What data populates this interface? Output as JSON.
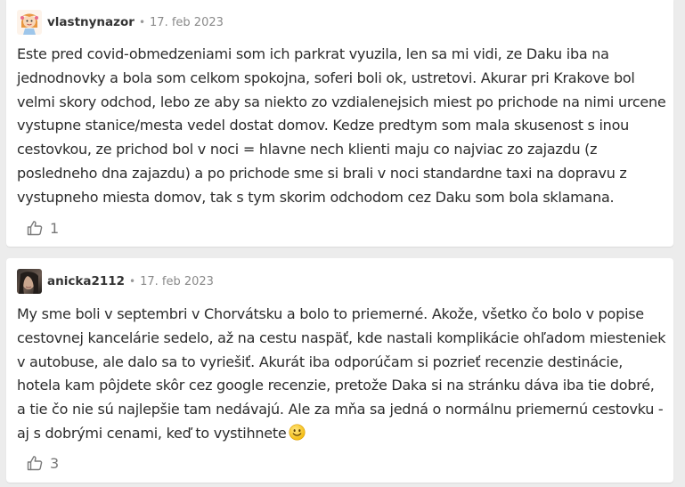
{
  "comments": [
    {
      "username": "vlastnynazor",
      "separator": "•",
      "date": "17. feb 2023",
      "avatar_icon": "girl-avatar-icon",
      "text": "Este pred covid-obmedzeniami som ich parkrat vyuzila, len sa mi vidi, ze Daku iba na jednodnovky a bola som celkom spokojna, soferi boli ok, ustretovi. Akurar pri Krakove bol velmi skory odchod, lebo ze aby sa niekto zo vzdialenejsich miest po prichode na nimi urcene vystupne stanice/mesta vedel dostat domov. Kedze predtym som mala skusenost s inou cestovkou, ze prichod bol v noci = hlavne nech klienti maju co najviac zo zajazdu (z posledneho dna zajazdu) a po prichode sme si brali v noci standardne taxi na dopravu z vystupneho miesta domov, tak s tym skorim odchodom cez Daku som bola sklamana.",
      "likes": "1"
    },
    {
      "username": "anicka2112",
      "separator": "•",
      "date": "17. feb 2023",
      "avatar_icon": "photo-avatar-icon",
      "text": "My sme boli v septembri v Chorvátsku a bolo to priemerné. Akože, všetko čo bolo v popise cestovnej kancelárie sedelo, až na cestu naspäť, kde nastali komplikácie ohľadom miesteniek v autobuse, ale dalo sa to vyriešiť. Akurát iba odporúčam si pozrieť recenzie destinácie, hotela kam pôjdete skôr cez google recenzie, pretože Daka si na stránku dáva iba tie dobré, a tie čo nie sú najlepšie tam nedávajú. Ale za mňa sa jedná o normálnu priemernú cestovku - aj s dobrými cenami, keď to vystihnete",
      "emoji": "smiley-emoji-icon",
      "likes": "3"
    }
  ],
  "colors": {
    "background": "#ececec",
    "card": "#ffffff",
    "text": "#2c2c2c",
    "muted": "#8a8a8a",
    "emoji_yellow": "#f5c518"
  },
  "icons": {
    "like": "thumbs-up-icon"
  }
}
